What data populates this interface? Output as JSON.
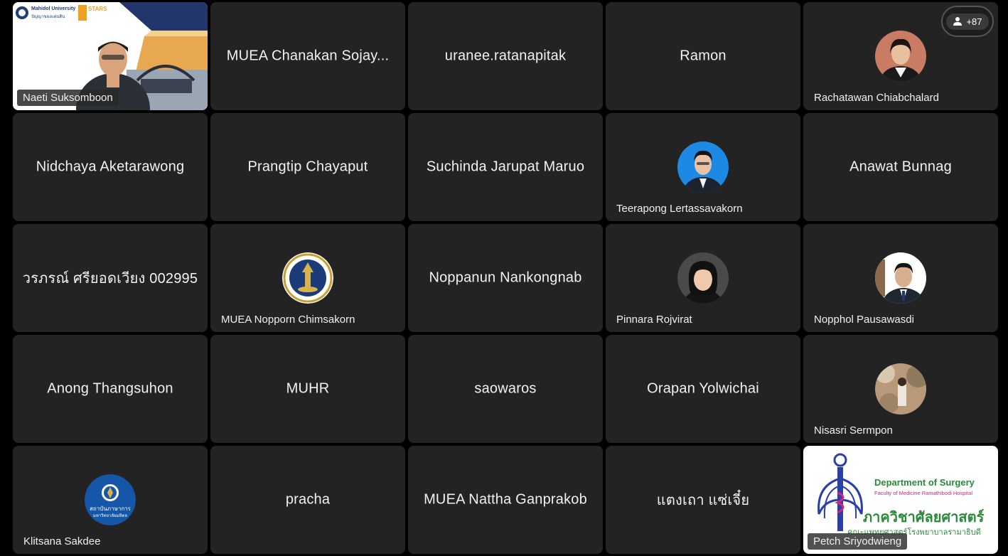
{
  "participant_count": "+87",
  "tiles": [
    {
      "name": "Naeti Suksomboon",
      "type": "video"
    },
    {
      "name": "MUEA Chanakan Sojay...",
      "type": "name"
    },
    {
      "name": "uranee.ratanapitak",
      "type": "name"
    },
    {
      "name": "Ramon",
      "type": "name"
    },
    {
      "name": "Rachatawan Chiabchalard",
      "type": "avatar",
      "icon": "woman-portrait"
    },
    {
      "name": "Nidchaya Aketarawong",
      "type": "name"
    },
    {
      "name": "Prangtip Chayaput",
      "type": "name"
    },
    {
      "name": "Suchinda Jarupat Maruo",
      "type": "name"
    },
    {
      "name": "Teerapong Lertassavakorn",
      "type": "avatar",
      "icon": "man-portrait-blue"
    },
    {
      "name": "Anawat Bunnag",
      "type": "name"
    },
    {
      "name": "วรภรณ์ ศรียอดเวียง 002995",
      "type": "name"
    },
    {
      "name": "MUEA Nopporn Chimsakorn",
      "type": "avatar",
      "icon": "university-seal"
    },
    {
      "name": "Noppanun Nankongnab",
      "type": "name"
    },
    {
      "name": "Pinnara Rojvirat",
      "type": "avatar",
      "icon": "woman-portrait"
    },
    {
      "name": "Nopphol Pausawasdi",
      "type": "avatar",
      "icon": "man-portrait-suit"
    },
    {
      "name": "Anong Thangsuhon",
      "type": "name"
    },
    {
      "name": "MUHR",
      "type": "name"
    },
    {
      "name": "saowaros",
      "type": "name"
    },
    {
      "name": "Orapan Yolwichai",
      "type": "name"
    },
    {
      "name": "Nisasri Sermpon",
      "type": "avatar",
      "icon": "outdoor-portrait"
    },
    {
      "name": "Klitsana Sakdee",
      "type": "avatar",
      "icon": "institute-logo"
    },
    {
      "name": "pracha",
      "type": "name"
    },
    {
      "name": "MUEA Nattha Ganprakob",
      "type": "name"
    },
    {
      "name": "แตงเถา แซ่เจี๋ย",
      "type": "name"
    },
    {
      "name": "Petch Sriyodwieng",
      "type": "surgery"
    }
  ],
  "video": {
    "uni": "Mahidol University",
    "uni_sub": "ปัญญาของแผ่นดิน",
    "stars": "STARS"
  },
  "surgery": {
    "line1": "Department of Surgery",
    "line2": "Faculty of Medicine Ramathibodi Hospital",
    "line3": "ภาควิชาศัลยศาสตร์",
    "line4": "คณะแพทยศาสตร์โรงพยาบาลรามาธิบดี"
  },
  "institute": {
    "line1": "สถาบันภาษาการ",
    "line2": "มหาวิทยาลัยมหิดล"
  }
}
